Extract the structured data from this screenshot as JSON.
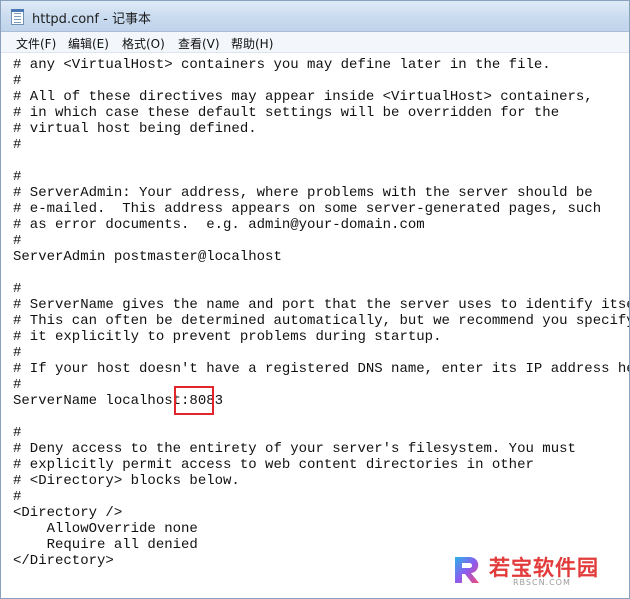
{
  "window": {
    "title": "httpd.conf - 记事本"
  },
  "menu": {
    "items": [
      {
        "label": "文件(F)"
      },
      {
        "label": "编辑(E)"
      },
      {
        "label": "格式(O)"
      },
      {
        "label": "查看(V)"
      },
      {
        "label": "帮助(H)"
      }
    ]
  },
  "editor": {
    "lines": [
      "# any <VirtualHost> containers you may define later in the file.",
      "#",
      "# All of these directives may appear inside <VirtualHost> containers,",
      "# in which case these default settings will be overridden for the",
      "# virtual host being defined.",
      "#",
      "",
      "#",
      "# ServerAdmin: Your address, where problems with the server should be",
      "# e-mailed.  This address appears on some server-generated pages, such",
      "# as error documents.  e.g. admin@your-domain.com",
      "#",
      "ServerAdmin postmaster@localhost",
      "",
      "#",
      "# ServerName gives the name and port that the server uses to identify itself.",
      "# This can often be determined automatically, but we recommend you specify",
      "# it explicitly to prevent problems during startup.",
      "#",
      "# If your host doesn't have a registered DNS name, enter its IP address here.",
      "#",
      "ServerName localhost:8083",
      "",
      "#",
      "# Deny access to the entirety of your server's filesystem. You must",
      "# explicitly permit access to web content directories in other",
      "# <Directory> blocks below.",
      "#",
      "<Directory />",
      "    AllowOverride none",
      "    Require all denied",
      "</Directory>",
      "",
      "",
      "#"
    ]
  },
  "watermark": {
    "name": "若宝软件园",
    "site": "RBSCN.COM"
  },
  "colors": {
    "highlight_box": "#e0262a",
    "watermark_red": "#e23b3b"
  }
}
